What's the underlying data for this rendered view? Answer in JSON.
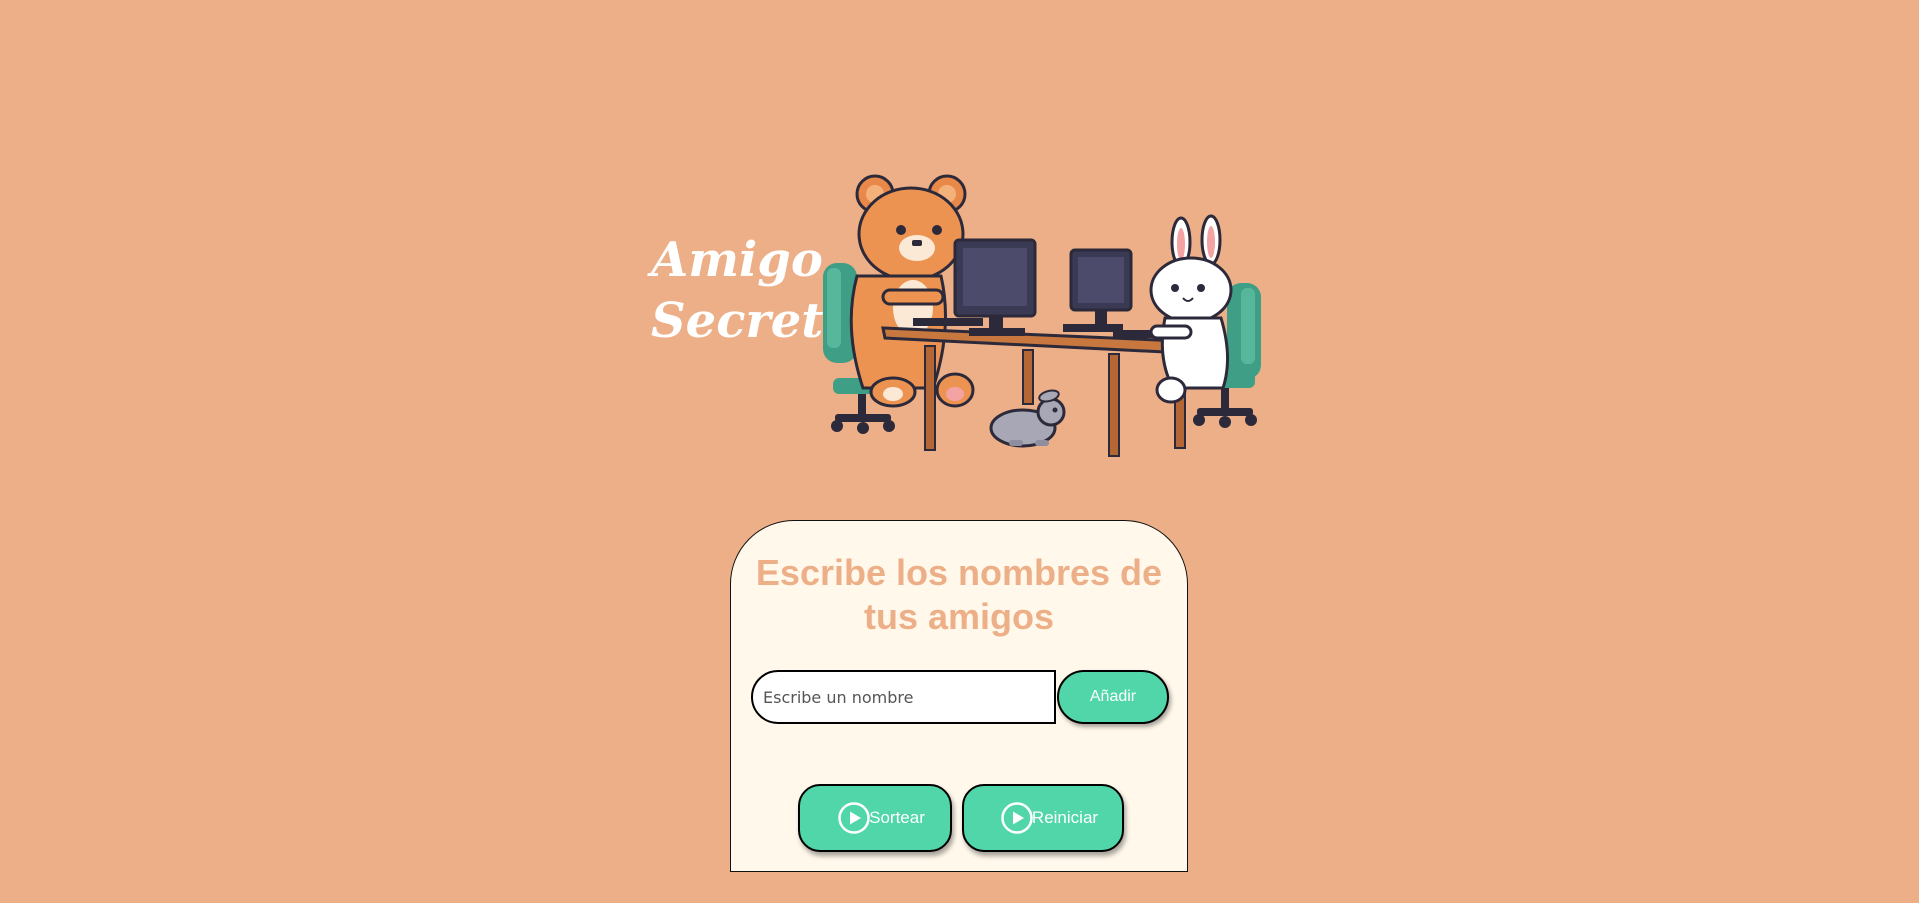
{
  "header": {
    "title_line1": "Amigo",
    "title_line2": "Secreto",
    "hero_image": "pixel-art-bear-and-bunny-at-computers-icon"
  },
  "card": {
    "heading": "Escribe los nombres de tus amigos",
    "input": {
      "placeholder": "Escribe un nombre",
      "value": ""
    },
    "add_button": "Añadir",
    "sortear_button": "Sortear",
    "reiniciar_button": "Reiniciar",
    "button_icon": "play-circle-icon"
  },
  "colors": {
    "background": "#EDAF87",
    "card": "#FFF8EB",
    "accent": "#50D6A9",
    "heading": "#EDAF87"
  }
}
